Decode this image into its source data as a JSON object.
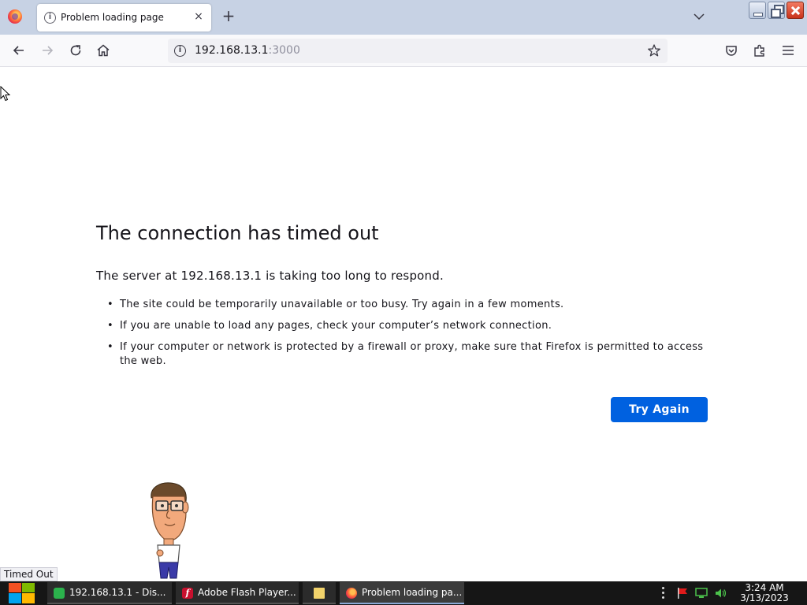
{
  "browser": {
    "tab": {
      "title": "Problem loading page",
      "close": "×"
    },
    "new_tab": "+",
    "url": {
      "host": "192.168.13.1",
      "port": ":3000"
    },
    "status_text": "Timed Out"
  },
  "error_page": {
    "title": "The connection has timed out",
    "description": "The server at 192.168.13.1 is taking too long to respond.",
    "suggestions": [
      "The site could be temporarily unavailable or too busy. Try again in a few moments.",
      "If you are unable to load any pages, check your computer’s network connection.",
      "If your computer or network is protected by a firewall or proxy, make sure that Firefox is permitted to access the web."
    ],
    "try_again_label": "Try Again",
    "accent_color": "#0061e0"
  },
  "taskbar": {
    "tasks": [
      {
        "label": "192.168.13.1 - Dis...",
        "icon": "chat-app-icon",
        "color": "#2bb24c"
      },
      {
        "label": "Adobe Flash Player...",
        "icon": "flash-icon",
        "color": "#c8102e"
      },
      {
        "label": "",
        "icon": "folder-icon",
        "color": "#f2d36b"
      },
      {
        "label": "Problem loading pa...",
        "icon": "firefox-icon",
        "color": "#ff7139"
      }
    ],
    "clock": {
      "time": "3:24 AM",
      "date": "3/13/2023"
    }
  }
}
